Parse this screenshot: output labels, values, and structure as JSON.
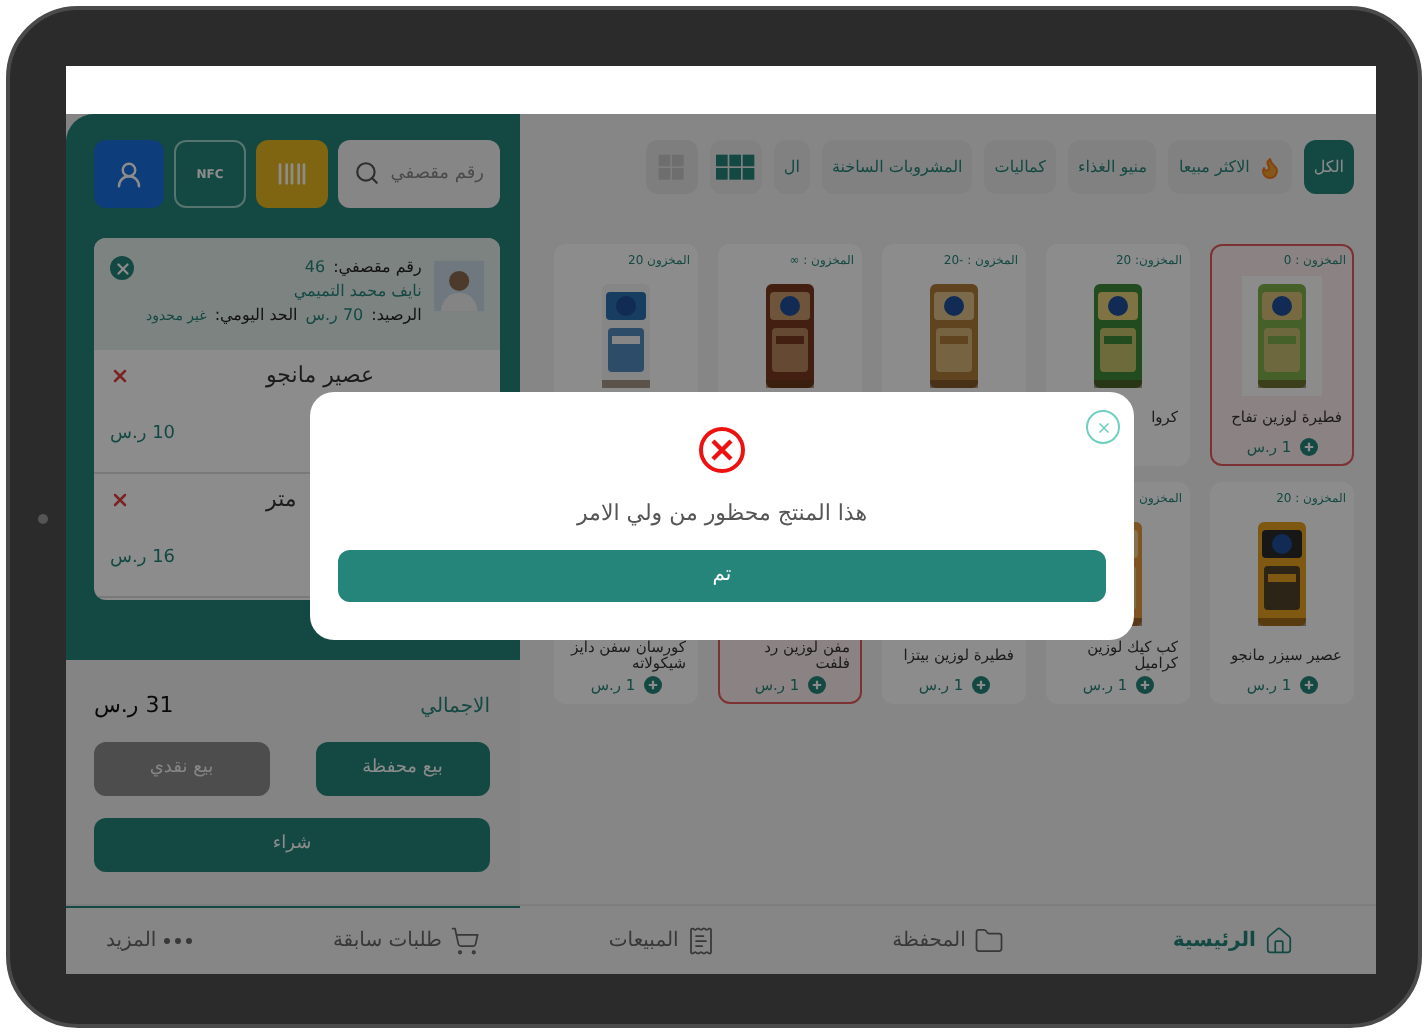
{
  "cart_panel": {
    "search": {
      "placeholder": "رقم مقصفي"
    },
    "nfc_label": "NFC",
    "customer": {
      "card_label": "رقم مقصفي:",
      "card_number": "46",
      "name": "نايف محمد التميمي",
      "balance_label": "الرصيد:",
      "balance": "70 ر.س",
      "limit_label": "الحد اليومي:",
      "limit": "غير محدود"
    },
    "items": [
      {
        "name": "عصير مانجو",
        "price": "10 ر.س"
      },
      {
        "name": "متر",
        "price": "16 ر.س"
      }
    ],
    "total_label": "الاجمالي",
    "total": "31 ر.س",
    "sale_buttons": [
      {
        "label": "بيع محفظة",
        "disabled": false
      },
      {
        "label": "بيع نقدي",
        "disabled": true
      }
    ],
    "buy_button": "شراء"
  },
  "categories": [
    {
      "label": "الكل",
      "selected": true,
      "kind": "plain"
    },
    {
      "label": "الاكثر مبيعا",
      "selected": false,
      "kind": "hot"
    },
    {
      "label": "منيو الغذاء",
      "selected": false,
      "kind": "plain"
    },
    {
      "label": "كماليات",
      "selected": false,
      "kind": "plain"
    },
    {
      "label": "المشروبات الساخنة",
      "selected": false,
      "kind": "plain"
    },
    {
      "label": "ال",
      "selected": false,
      "kind": "plain"
    }
  ],
  "view_toggles": [
    {
      "kind": "grid6",
      "selected": true
    },
    {
      "kind": "grid4",
      "selected": false
    }
  ],
  "products": [
    {
      "stock": "المخزون : 0",
      "name": "فطيرة لوزين تفاح",
      "price": "1 ر.س",
      "highlighted": true
    },
    {
      "stock": "المخزون: 20",
      "name": "كروا",
      "highlighted": false
    },
    {
      "stock": "المخزون : -20",
      "highlighted": false
    },
    {
      "stock": "المخزون : ∞",
      "highlighted": false
    },
    {
      "stock": "المخزون 20",
      "highlighted": false
    },
    {
      "stock": "المخزون : 20",
      "name": "عصير سيزر مانجو",
      "price": "1 ر.س",
      "highlighted": false
    },
    {
      "stock": "المخزون",
      "name": "كب كيك لوزين كراميل",
      "price": "1 ر.س",
      "highlighted": false
    },
    {
      "name": "فطيرة لوزين بيتزا",
      "price": "1 ر.س",
      "highlighted": false
    },
    {
      "name": "مفن لوزين رد فلفت",
      "price": "1 ر.س",
      "highlighted": true
    },
    {
      "name": "كورسان سفن دايز شيكولاته",
      "price": "1 ر.س",
      "highlighted": false
    }
  ],
  "bottom_nav": [
    {
      "label": "الرئيسية",
      "selected": true
    },
    {
      "label": "المحفظة",
      "selected": false
    },
    {
      "label": "المبيعات",
      "selected": false
    },
    {
      "label": "طلبات سابقة",
      "selected": false
    },
    {
      "label": "المزيد",
      "selected": false
    }
  ],
  "dialog": {
    "message": "هذا المنتج محظور من ولي الامر",
    "button": "تم"
  }
}
